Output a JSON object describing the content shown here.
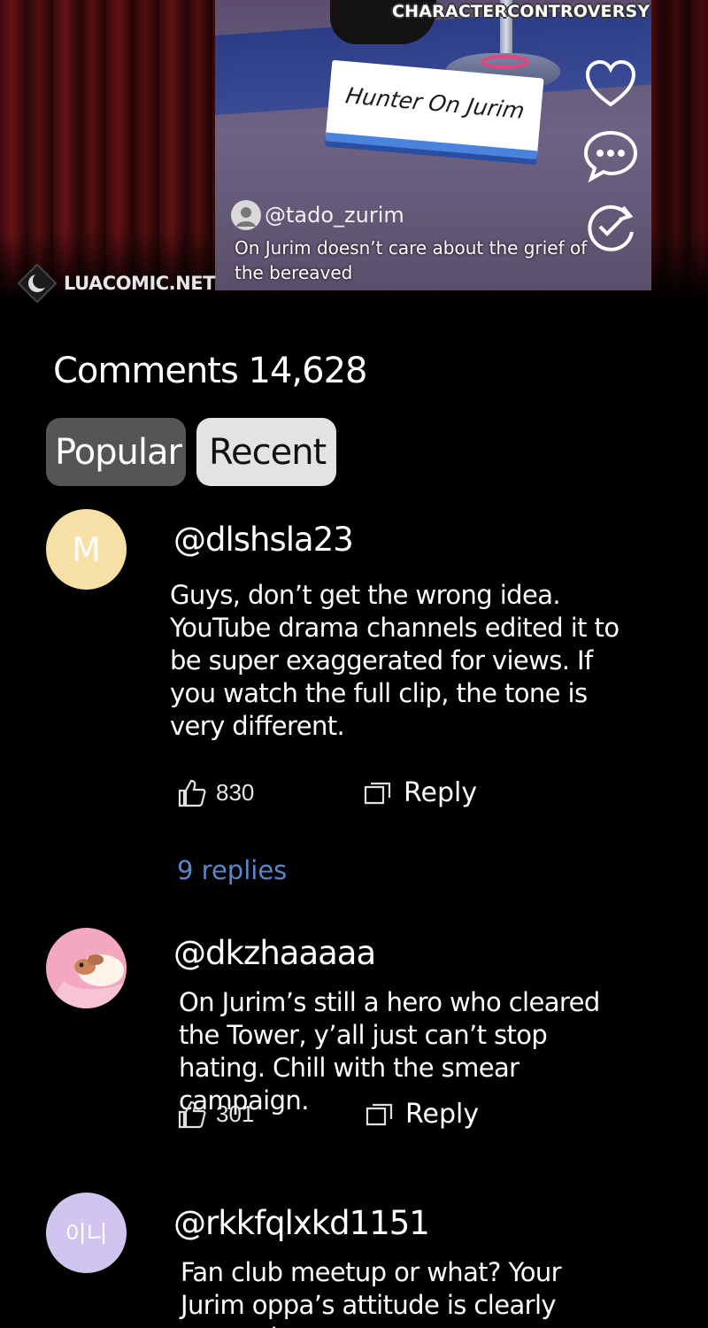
{
  "video": {
    "tagline": "CHARACTERCONTROVERSY",
    "nameplate": "Hunter On Jurim",
    "handle": "@tado_zurim",
    "caption": "On Jurim doesn’t care about the grief of the bereaved",
    "icons": [
      "heart-icon",
      "comment-bubble-icon",
      "share-icon"
    ]
  },
  "watermark": {
    "text": "LUACOMIC.NET"
  },
  "comments_header": {
    "title": "Comments 14,628"
  },
  "tabs": [
    {
      "label": "Popular",
      "active": false
    },
    {
      "label": "Recent",
      "active": true
    }
  ],
  "comments": [
    {
      "avatar_text": "M",
      "avatar_color": "#f7e0a6",
      "username": "@dlshsla23",
      "text": "Guys, don’t get the wrong idea. YouTube drama channels edited it to be super exaggerated for views. If you watch the full clip, the tone is very different.",
      "likes": "830",
      "reply_label": "Reply",
      "replies": "9 replies"
    },
    {
      "avatar_text": "",
      "avatar_color": "#f4a7c0",
      "username": "@dkzhaaaaa",
      "text": "On Jurim’s still a hero who cleared the Tower, y’all just can’t stop hating. Chill with the smear campaign.",
      "likes": "301",
      "reply_label": "Reply"
    },
    {
      "avatar_text": "이니",
      "avatar_color": "#cfc5ee",
      "username": "@rkkfqlxkd1151",
      "text": "Fan club meetup or what? Your Jurim oppa’s attitude is clearly messed up,"
    }
  ]
}
